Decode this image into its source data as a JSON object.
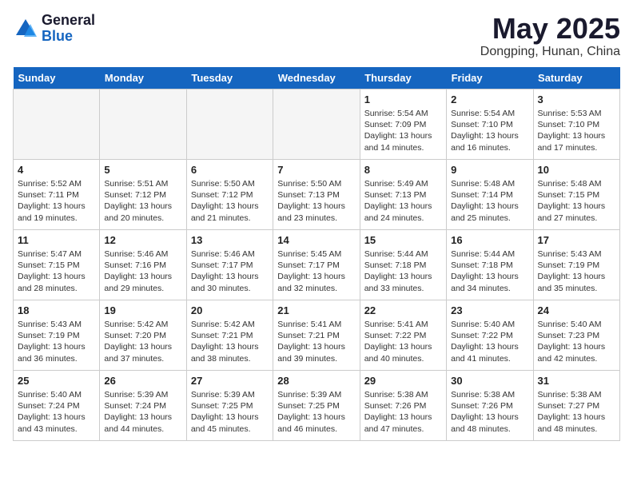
{
  "header": {
    "logo_general": "General",
    "logo_blue": "Blue",
    "month": "May 2025",
    "location": "Dongping, Hunan, China"
  },
  "days_of_week": [
    "Sunday",
    "Monday",
    "Tuesday",
    "Wednesday",
    "Thursday",
    "Friday",
    "Saturday"
  ],
  "weeks": [
    [
      {
        "day": "",
        "info": "",
        "empty": true
      },
      {
        "day": "",
        "info": "",
        "empty": true
      },
      {
        "day": "",
        "info": "",
        "empty": true
      },
      {
        "day": "",
        "info": "",
        "empty": true
      },
      {
        "day": "1",
        "info": "Sunrise: 5:54 AM\nSunset: 7:09 PM\nDaylight: 13 hours\nand 14 minutes.",
        "empty": false
      },
      {
        "day": "2",
        "info": "Sunrise: 5:54 AM\nSunset: 7:10 PM\nDaylight: 13 hours\nand 16 minutes.",
        "empty": false
      },
      {
        "day": "3",
        "info": "Sunrise: 5:53 AM\nSunset: 7:10 PM\nDaylight: 13 hours\nand 17 minutes.",
        "empty": false
      }
    ],
    [
      {
        "day": "4",
        "info": "Sunrise: 5:52 AM\nSunset: 7:11 PM\nDaylight: 13 hours\nand 19 minutes.",
        "empty": false
      },
      {
        "day": "5",
        "info": "Sunrise: 5:51 AM\nSunset: 7:12 PM\nDaylight: 13 hours\nand 20 minutes.",
        "empty": false
      },
      {
        "day": "6",
        "info": "Sunrise: 5:50 AM\nSunset: 7:12 PM\nDaylight: 13 hours\nand 21 minutes.",
        "empty": false
      },
      {
        "day": "7",
        "info": "Sunrise: 5:50 AM\nSunset: 7:13 PM\nDaylight: 13 hours\nand 23 minutes.",
        "empty": false
      },
      {
        "day": "8",
        "info": "Sunrise: 5:49 AM\nSunset: 7:13 PM\nDaylight: 13 hours\nand 24 minutes.",
        "empty": false
      },
      {
        "day": "9",
        "info": "Sunrise: 5:48 AM\nSunset: 7:14 PM\nDaylight: 13 hours\nand 25 minutes.",
        "empty": false
      },
      {
        "day": "10",
        "info": "Sunrise: 5:48 AM\nSunset: 7:15 PM\nDaylight: 13 hours\nand 27 minutes.",
        "empty": false
      }
    ],
    [
      {
        "day": "11",
        "info": "Sunrise: 5:47 AM\nSunset: 7:15 PM\nDaylight: 13 hours\nand 28 minutes.",
        "empty": false
      },
      {
        "day": "12",
        "info": "Sunrise: 5:46 AM\nSunset: 7:16 PM\nDaylight: 13 hours\nand 29 minutes.",
        "empty": false
      },
      {
        "day": "13",
        "info": "Sunrise: 5:46 AM\nSunset: 7:17 PM\nDaylight: 13 hours\nand 30 minutes.",
        "empty": false
      },
      {
        "day": "14",
        "info": "Sunrise: 5:45 AM\nSunset: 7:17 PM\nDaylight: 13 hours\nand 32 minutes.",
        "empty": false
      },
      {
        "day": "15",
        "info": "Sunrise: 5:44 AM\nSunset: 7:18 PM\nDaylight: 13 hours\nand 33 minutes.",
        "empty": false
      },
      {
        "day": "16",
        "info": "Sunrise: 5:44 AM\nSunset: 7:18 PM\nDaylight: 13 hours\nand 34 minutes.",
        "empty": false
      },
      {
        "day": "17",
        "info": "Sunrise: 5:43 AM\nSunset: 7:19 PM\nDaylight: 13 hours\nand 35 minutes.",
        "empty": false
      }
    ],
    [
      {
        "day": "18",
        "info": "Sunrise: 5:43 AM\nSunset: 7:19 PM\nDaylight: 13 hours\nand 36 minutes.",
        "empty": false
      },
      {
        "day": "19",
        "info": "Sunrise: 5:42 AM\nSunset: 7:20 PM\nDaylight: 13 hours\nand 37 minutes.",
        "empty": false
      },
      {
        "day": "20",
        "info": "Sunrise: 5:42 AM\nSunset: 7:21 PM\nDaylight: 13 hours\nand 38 minutes.",
        "empty": false
      },
      {
        "day": "21",
        "info": "Sunrise: 5:41 AM\nSunset: 7:21 PM\nDaylight: 13 hours\nand 39 minutes.",
        "empty": false
      },
      {
        "day": "22",
        "info": "Sunrise: 5:41 AM\nSunset: 7:22 PM\nDaylight: 13 hours\nand 40 minutes.",
        "empty": false
      },
      {
        "day": "23",
        "info": "Sunrise: 5:40 AM\nSunset: 7:22 PM\nDaylight: 13 hours\nand 41 minutes.",
        "empty": false
      },
      {
        "day": "24",
        "info": "Sunrise: 5:40 AM\nSunset: 7:23 PM\nDaylight: 13 hours\nand 42 minutes.",
        "empty": false
      }
    ],
    [
      {
        "day": "25",
        "info": "Sunrise: 5:40 AM\nSunset: 7:24 PM\nDaylight: 13 hours\nand 43 minutes.",
        "empty": false
      },
      {
        "day": "26",
        "info": "Sunrise: 5:39 AM\nSunset: 7:24 PM\nDaylight: 13 hours\nand 44 minutes.",
        "empty": false
      },
      {
        "day": "27",
        "info": "Sunrise: 5:39 AM\nSunset: 7:25 PM\nDaylight: 13 hours\nand 45 minutes.",
        "empty": false
      },
      {
        "day": "28",
        "info": "Sunrise: 5:39 AM\nSunset: 7:25 PM\nDaylight: 13 hours\nand 46 minutes.",
        "empty": false
      },
      {
        "day": "29",
        "info": "Sunrise: 5:38 AM\nSunset: 7:26 PM\nDaylight: 13 hours\nand 47 minutes.",
        "empty": false
      },
      {
        "day": "30",
        "info": "Sunrise: 5:38 AM\nSunset: 7:26 PM\nDaylight: 13 hours\nand 48 minutes.",
        "empty": false
      },
      {
        "day": "31",
        "info": "Sunrise: 5:38 AM\nSunset: 7:27 PM\nDaylight: 13 hours\nand 48 minutes.",
        "empty": false
      }
    ]
  ]
}
